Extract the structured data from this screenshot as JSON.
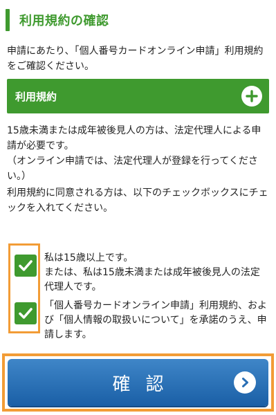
{
  "section": {
    "title": "利用規約の確認"
  },
  "intro": "申請にあたり、「個人番号カードオンライン申請」利用規約をご確認ください。",
  "terms_accordion": {
    "label": "利用規約",
    "icon": "plus-circle-icon"
  },
  "notice": {
    "line1": "15歳未満または成年被後見人の方は、法定代理人による申請が必要です。",
    "line2": "（オンライン申請では、法定代理人が登録を行ってください。）"
  },
  "instruction": "利用規約に同意される方は、以下のチェックボックスにチェックを入れてください。",
  "checkboxes": [
    {
      "line1": "私は15歳以上です。",
      "line2": "または、私は15歳未満または成年被後見人の法定代理人です。",
      "checked": true
    },
    {
      "line1": "「個人番号カードオンライン申請」利用規約、および「個人情報の取扱いについて」を承諾のうえ、申請します。",
      "checked": true
    }
  ],
  "confirm_button": {
    "label": "確認",
    "icon": "chevron-right-circle-icon"
  },
  "colors": {
    "green": "#3f9a2f",
    "blue": "#2a6fb5",
    "highlight": "#f29c36"
  }
}
